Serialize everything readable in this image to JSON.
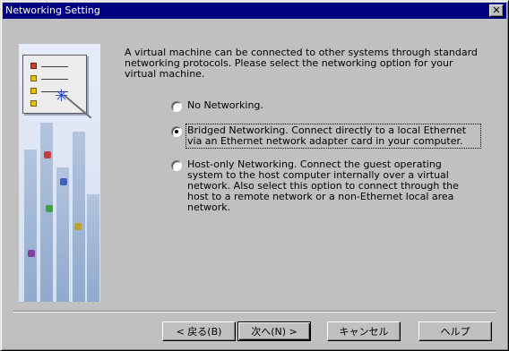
{
  "window": {
    "title": "Networking Setting",
    "close_glyph": "✕"
  },
  "intro_text": "A virtual machine can be connected to other systems through standard networking protocols. Please select the networking option for your virtual machine.",
  "options": [
    {
      "label": "No Networking.",
      "checked": false
    },
    {
      "label": "Bridged Networking. Connect directly to a local Ethernet via an Ethernet network adapter card in your computer.",
      "checked": true
    },
    {
      "label": "Host-only Networking. Connect the guest operating system to the host computer internally over a virtual network. Also select this option to connect through the host to a remote network or a non-Ethernet local area network.",
      "checked": false
    }
  ],
  "buttons": {
    "back": "< 戻る(B)",
    "next": "次へ(N) >",
    "cancel": "キャンセル",
    "help": "ヘルプ"
  },
  "colors": {
    "titlebar": "#000080",
    "dialog": "#c0c0c0"
  },
  "icons": {
    "wizard_art": "wizard-illustration-icon",
    "close": "close-icon"
  }
}
